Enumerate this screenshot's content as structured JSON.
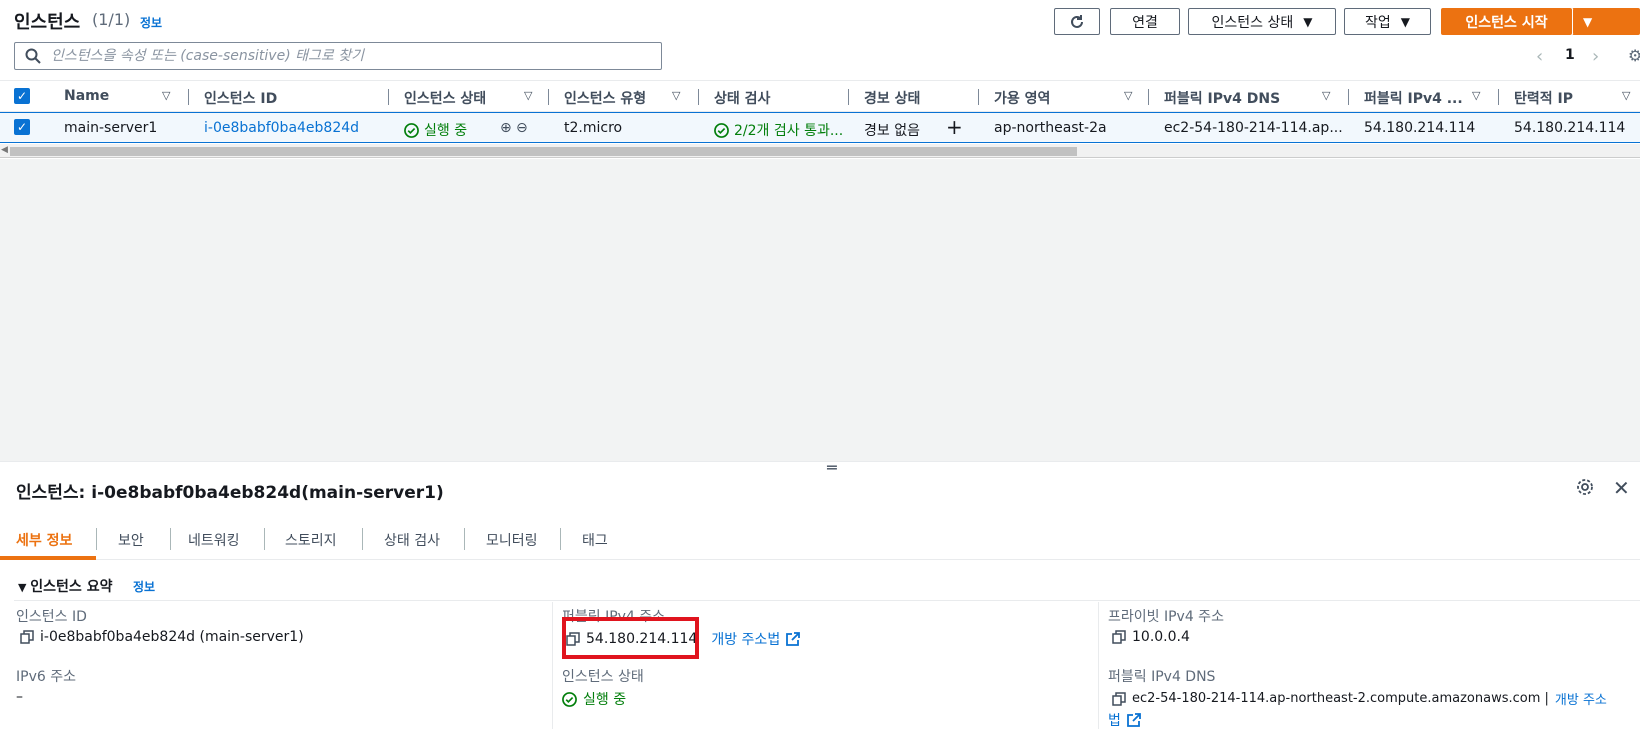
{
  "header": {
    "title": "인스턴스",
    "count": "(1/1)",
    "info": "정보",
    "buttons": {
      "connect": "연결",
      "instance_state": "인스턴스 상태",
      "actions": "작업",
      "launch": "인스턴스 시작"
    }
  },
  "search": {
    "placeholder": "인스턴스을 속성 또는 (case-sensitive) 태그로 찾기"
  },
  "pagination": {
    "page": "1"
  },
  "table": {
    "columns": [
      "Name",
      "인스턴스 ID",
      "인스턴스 상태",
      "인스턴스 유형",
      "상태 검사",
      "경보 상태",
      "가용 영역",
      "퍼블릭 IPv4 DNS",
      "퍼블릭 IPv4 ...",
      "탄력적 IP"
    ],
    "row": {
      "name": "main-server1",
      "instance_id": "i-0e8babf0ba4eb824d",
      "state": "실행 중",
      "type": "t2.micro",
      "status_check": "2/2개 검사 통과...",
      "alarm": "경보 없음",
      "az": "ap-northeast-2a",
      "public_dns": "ec2-54-180-214-114.ap...",
      "public_ip": "54.180.214.114",
      "elastic_ip": "54.180.214.114"
    }
  },
  "detail": {
    "title": "인스턴스: i-0e8babf0ba4eb824d(main-server1)",
    "tabs": [
      "세부 정보",
      "보안",
      "네트워킹",
      "스토리지",
      "상태 검사",
      "모니터링",
      "태그"
    ],
    "summary_title": "인스턴스 요약",
    "summary_info": "정보",
    "fields": {
      "instance_id_label": "인스턴스 ID",
      "instance_id_value": "i-0e8babf0ba4eb824d (main-server1)",
      "ipv6_label": "IPv6 주소",
      "ipv6_value": "–",
      "public_ipv4_label": "퍼블릭 IPv4 주소",
      "public_ipv4_value": "54.180.214.114",
      "open_address_link": "개방 주소법",
      "instance_state_label": "인스턴스 상태",
      "instance_state_value": "실행 중",
      "private_ipv4_label": "프라이빗 IPv4 주소",
      "private_ipv4_value": "10.0.0.4",
      "public_dns_label": "퍼블릭 IPv4 DNS",
      "public_dns_value": "ec2-54-180-214-114.ap-northeast-2.compute.amazonaws.com |",
      "public_dns_link_a": "개방 주소",
      "public_dns_link_b": "법"
    }
  },
  "colors": {
    "accent": "#ec7211",
    "link": "#0972d3",
    "success": "#037f0c",
    "highlight": "#e0141e"
  },
  "icons": [
    "refresh-icon",
    "search-icon",
    "gear-icon",
    "close-icon",
    "copy-icon",
    "external-link-icon",
    "check-circle-icon",
    "zoom-in-icon",
    "zoom-out-icon",
    "plus-icon"
  ]
}
